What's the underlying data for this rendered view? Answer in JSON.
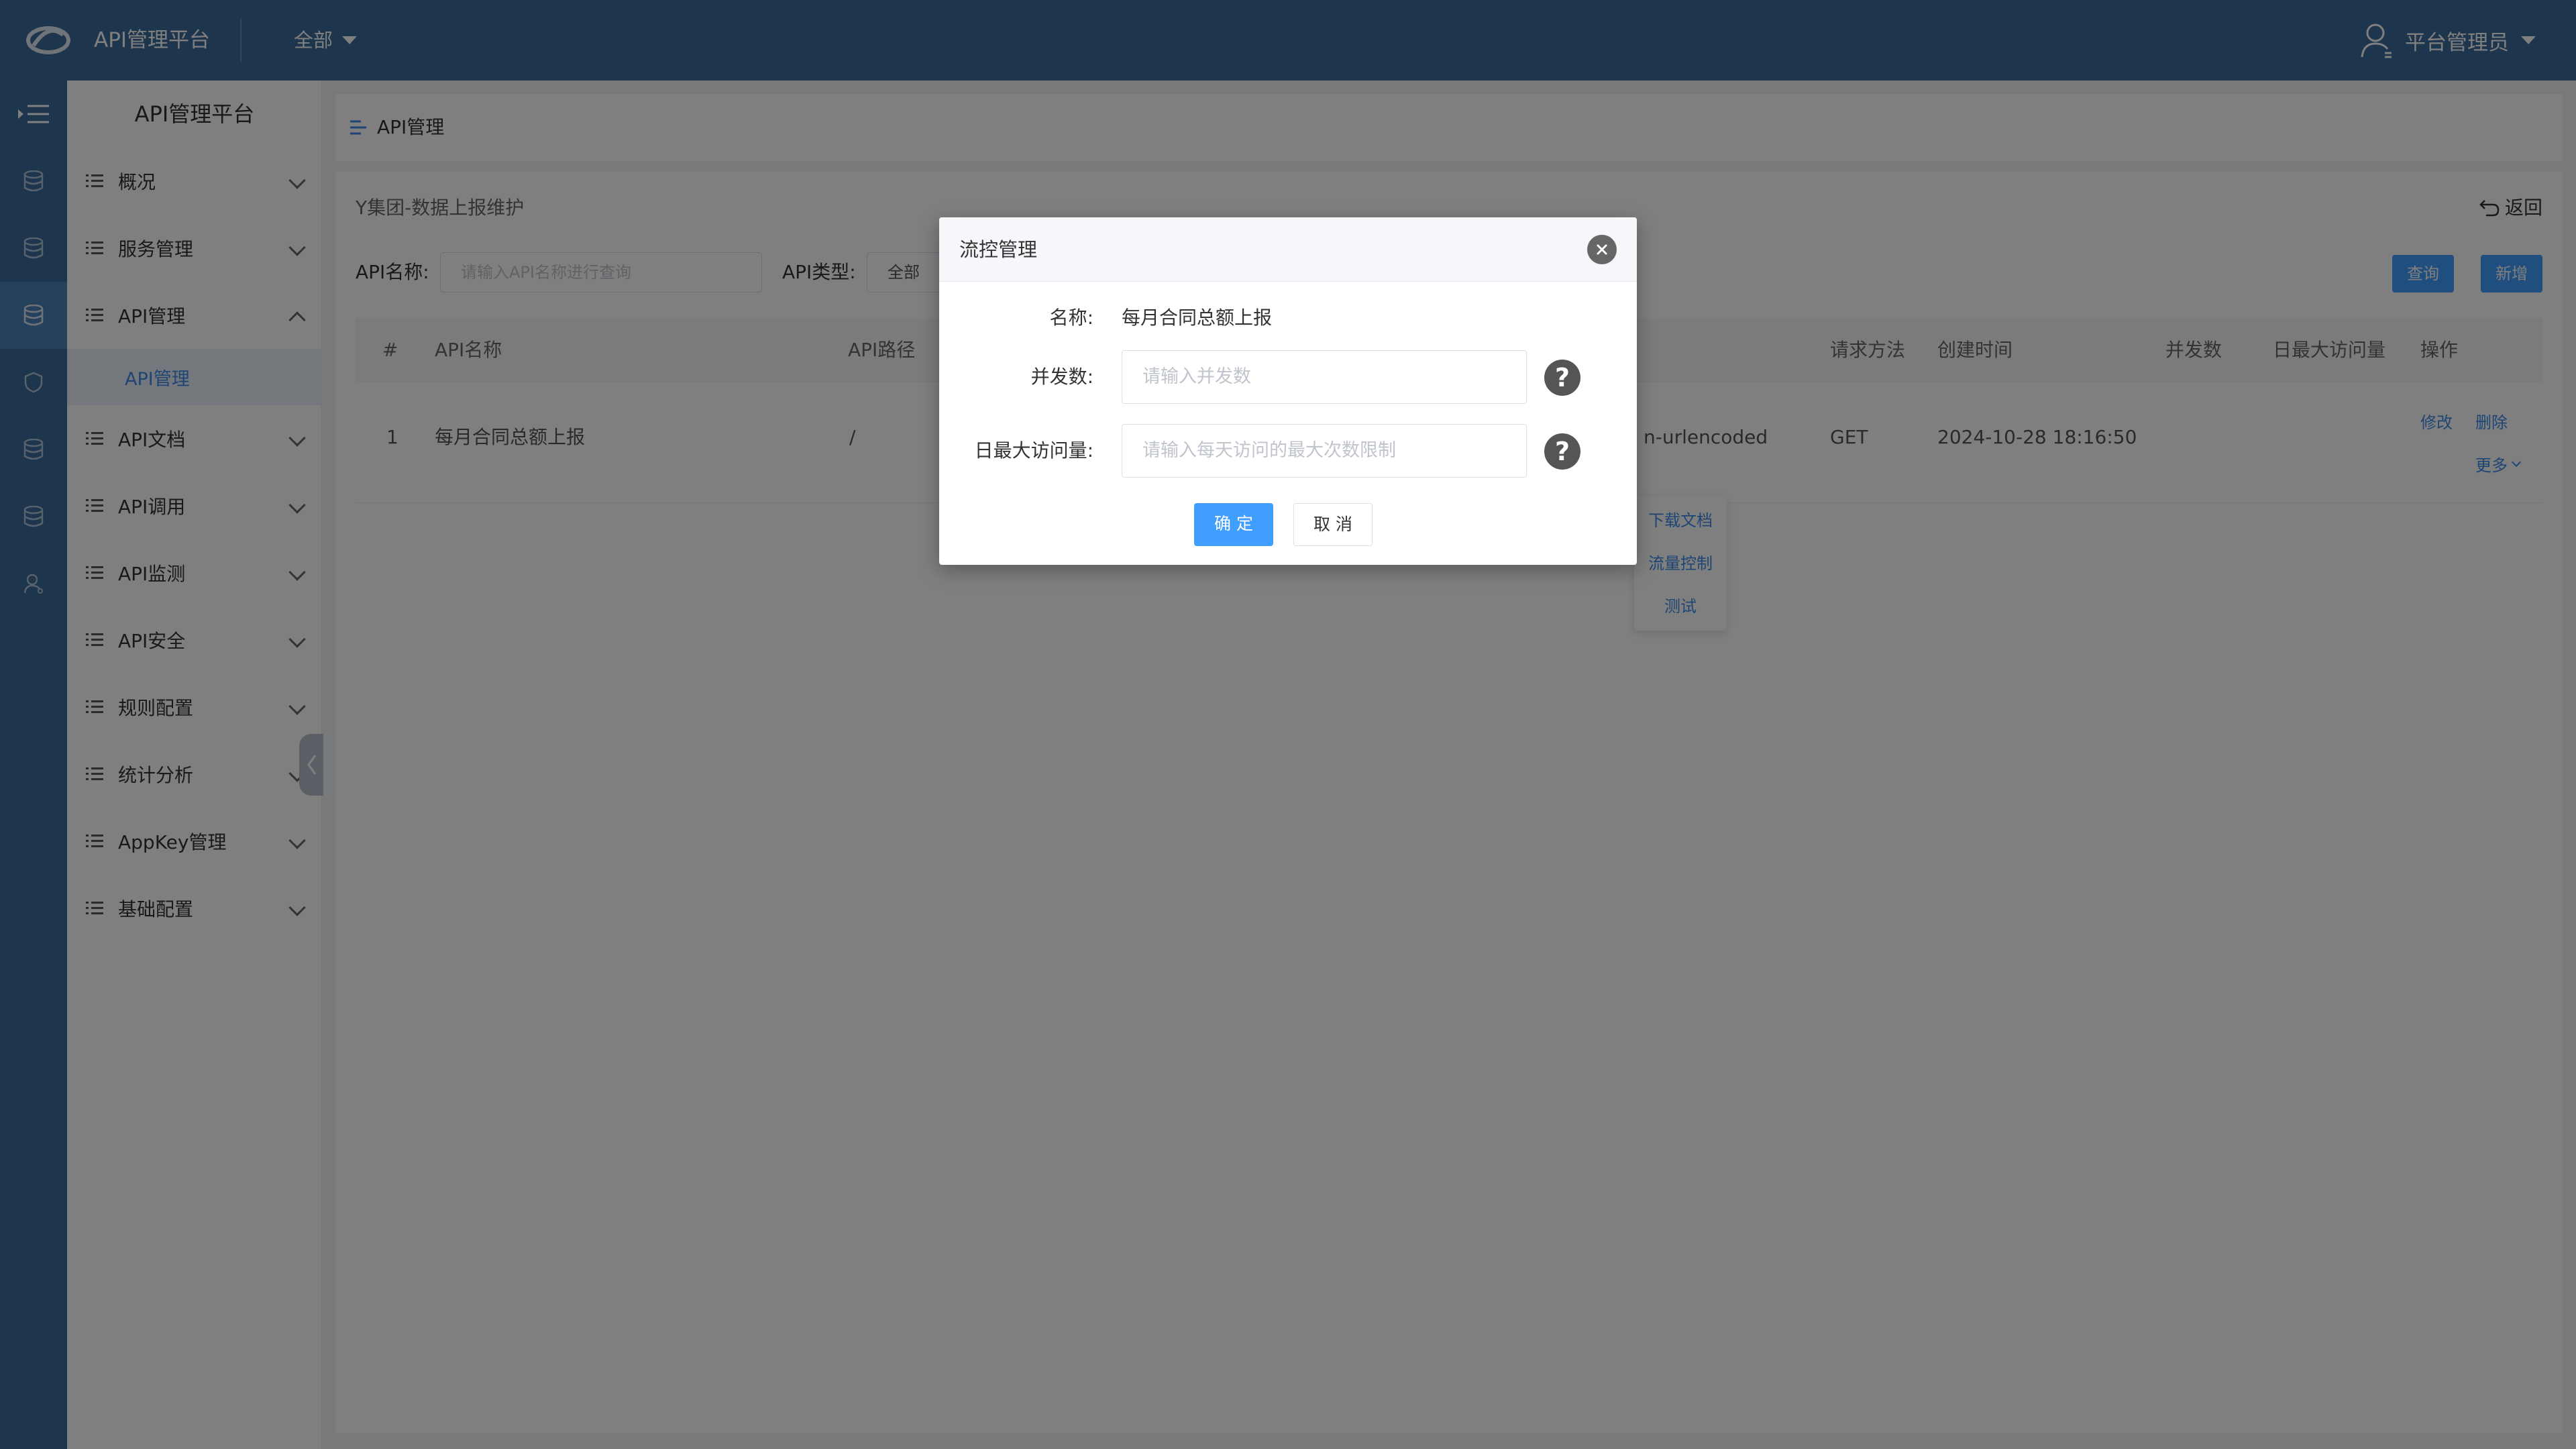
{
  "header": {
    "app_title": "API管理平台",
    "scope_select": "全部",
    "user_name": "平台管理员"
  },
  "sidebar": {
    "title": "API管理平台",
    "items": [
      {
        "label": "概况"
      },
      {
        "label": "服务管理"
      },
      {
        "label": "API管理",
        "expanded": true,
        "children": [
          {
            "label": "API管理"
          }
        ]
      },
      {
        "label": "API文档"
      },
      {
        "label": "API调用"
      },
      {
        "label": "API监测"
      },
      {
        "label": "API安全"
      },
      {
        "label": "规则配置"
      },
      {
        "label": "统计分析"
      },
      {
        "label": "AppKey管理"
      },
      {
        "label": "基础配置"
      }
    ]
  },
  "breadcrumb": {
    "label": "API管理"
  },
  "panel": {
    "path": "Y集团-数据上报维护",
    "back_label": "返回",
    "filters": {
      "api_name_label": "API名称:",
      "api_name_placeholder": "请输入API名称进行查询",
      "api_type_label": "API类型:",
      "api_type_value": "全部"
    },
    "query_button": "查询",
    "add_button": "新增"
  },
  "table": {
    "columns": [
      "#",
      "API名称",
      "API路径",
      "请求方法",
      "创建时间",
      "并发数",
      "日最大访问量",
      "操作"
    ],
    "rows": [
      {
        "index": "1",
        "name": "每月合同总额上报",
        "path": "/",
        "content_type_fragment": "n-urlencoded",
        "method": "GET",
        "created": "2024-10-28 18:16:50",
        "concurrency": "",
        "daily_max": "",
        "actions": {
          "edit": "修改",
          "delete": "删除",
          "more": "更多"
        }
      }
    ]
  },
  "more_dropdown": {
    "items": [
      "下载文档",
      "流量控制",
      "测试"
    ]
  },
  "modal": {
    "title": "流控管理",
    "name_label": "名称:",
    "name_value": "每月合同总额上报",
    "concurrency_label": "并发数:",
    "concurrency_placeholder": "请输入并发数",
    "daily_label": "日最大访问量:",
    "daily_placeholder": "请输入每天访问的最大次数限制",
    "help_glyph": "?",
    "confirm_label": "确 定",
    "cancel_label": "取 消"
  },
  "colors": {
    "header_bg": "#3a6a9a",
    "primary": "#409eff",
    "link": "#3d8be8",
    "overlay": "rgba(0,0,0,0.5)"
  }
}
